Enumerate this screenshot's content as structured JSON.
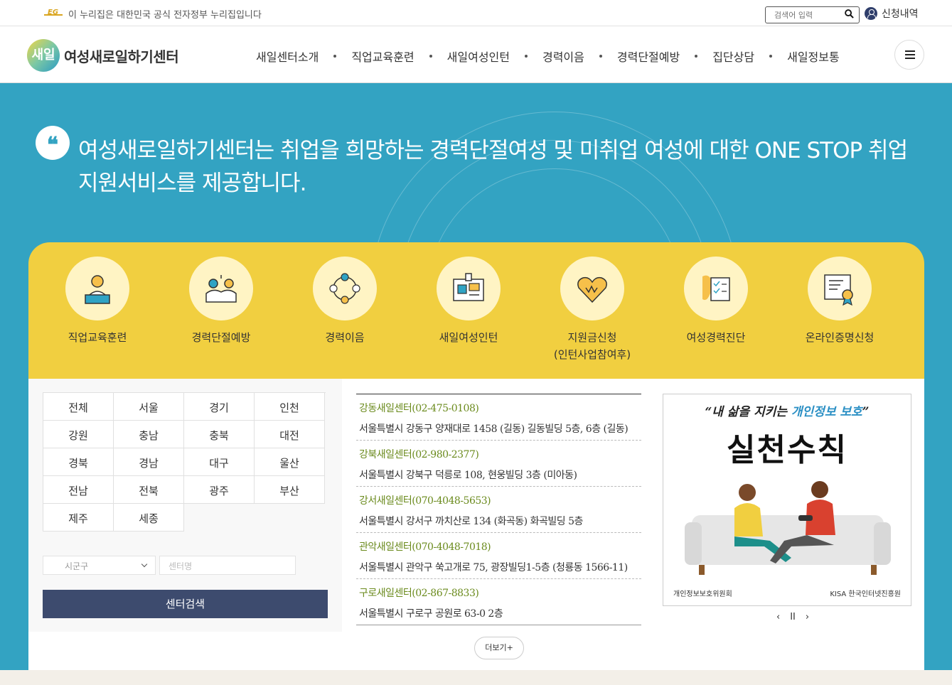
{
  "topbar": {
    "gov_notice": "이 누리집은 대한민국 공식 전자정부 누리집입니다",
    "gov_mark": "EG",
    "search_placeholder": "검색어 입력",
    "apply_link": "신청내역"
  },
  "header": {
    "logo_badge": "새일",
    "logo_text": "여성새로일하기센터",
    "nav": [
      "새일센터소개",
      "직업교육훈련",
      "새일여성인턴",
      "경력이음",
      "경력단절예방",
      "집단상담",
      "새일정보통"
    ]
  },
  "hero": {
    "quote_mark": "❝",
    "slogan": "여성새로일하기센터는 취업을 희망하는 경력단절여성 및 미취업 여성에 대한 ONE STOP 취업지원서비스를 제공합니다."
  },
  "quick_menu": [
    {
      "label": "직업교육훈련",
      "icon": "teacher-icon"
    },
    {
      "label": "경력단절예방",
      "icon": "high-five-icon"
    },
    {
      "label": "경력이음",
      "icon": "people-circle-icon"
    },
    {
      "label": "새일여성인턴",
      "icon": "id-card-icon"
    },
    {
      "label": "지원금신청",
      "label2": "(인턴사업참여후)",
      "icon": "heart-money-icon"
    },
    {
      "label": "여성경력진단",
      "icon": "checklist-map-icon"
    },
    {
      "label": "온라인증명신청",
      "icon": "certificate-icon"
    }
  ],
  "regions": [
    "전체",
    "서울",
    "경기",
    "인천",
    "강원",
    "충남",
    "충북",
    "대전",
    "경북",
    "경남",
    "대구",
    "울산",
    "전남",
    "전북",
    "광주",
    "부산",
    "제주",
    "세종"
  ],
  "filters": {
    "district_select": "시군구",
    "center_placeholder": "센터명",
    "search_button": "센터검색"
  },
  "centers": [
    {
      "name": "강동새일센터(02-475-0108)",
      "address": "서울특별시 강동구 양재대로 1458 (길동) 길동빌딩 5층, 6층 (길동)"
    },
    {
      "name": "강북새일센터(02-980-2377)",
      "address": "서울특별시 강북구 덕릉로 108, 현웅빌딩 3층 (미아동)"
    },
    {
      "name": "강서새일센터(070-4048-5653)",
      "address": "서울특별시 강서구 까치산로 134 (화곡동) 화곡빌딩 5층"
    },
    {
      "name": "관악새일센터(070-4048-7018)",
      "address": "서울특별시 관악구 쑥고개로 75, 광장빌딩1-5층 (청룡동 1566-11)"
    },
    {
      "name": "구로새일센터(02-867-8833)",
      "address": "서울특별시 구로구 공원로 63-0 2층"
    }
  ],
  "more_button": "더보기+",
  "banner": {
    "line1_pre": "“내 삶을 지키는 ",
    "line1_highlight": "개인정보 보호",
    "line1_post": "”",
    "line2": "실천수칙",
    "org1": "개인정보보호위원회",
    "org2": "KISA 한국인터넷진흥원",
    "prev": "‹",
    "pause": "II",
    "next": "›"
  },
  "colors": {
    "hero_bg": "#33a3c2",
    "quick_bg": "#f1cf40",
    "search_btn": "#3d4b6e",
    "center_name": "#6a8a1c"
  }
}
